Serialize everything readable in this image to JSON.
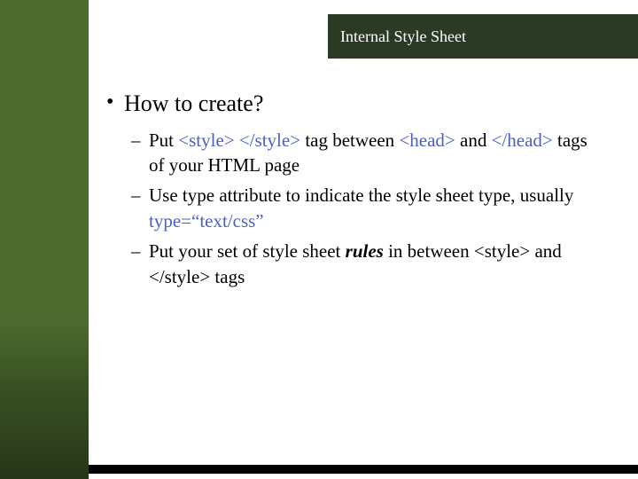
{
  "title": "Internal Style Sheet",
  "bullet": {
    "heading": "How to create?",
    "items": [
      {
        "t1": "Put ",
        "kw1": "<style> </style>",
        "t2": " tag between ",
        "kw2": "<head>",
        "t3": " and ",
        "kw3": "</head>",
        "t4": " tags of your HTML page"
      },
      {
        "t1": "Use type attribute to indicate the style sheet type, usually ",
        "kw1": "type=“text/css”"
      },
      {
        "t1": "Put your set of style sheet ",
        "em1": "rules",
        "t2": " in between <style> and </style> tags"
      }
    ]
  }
}
